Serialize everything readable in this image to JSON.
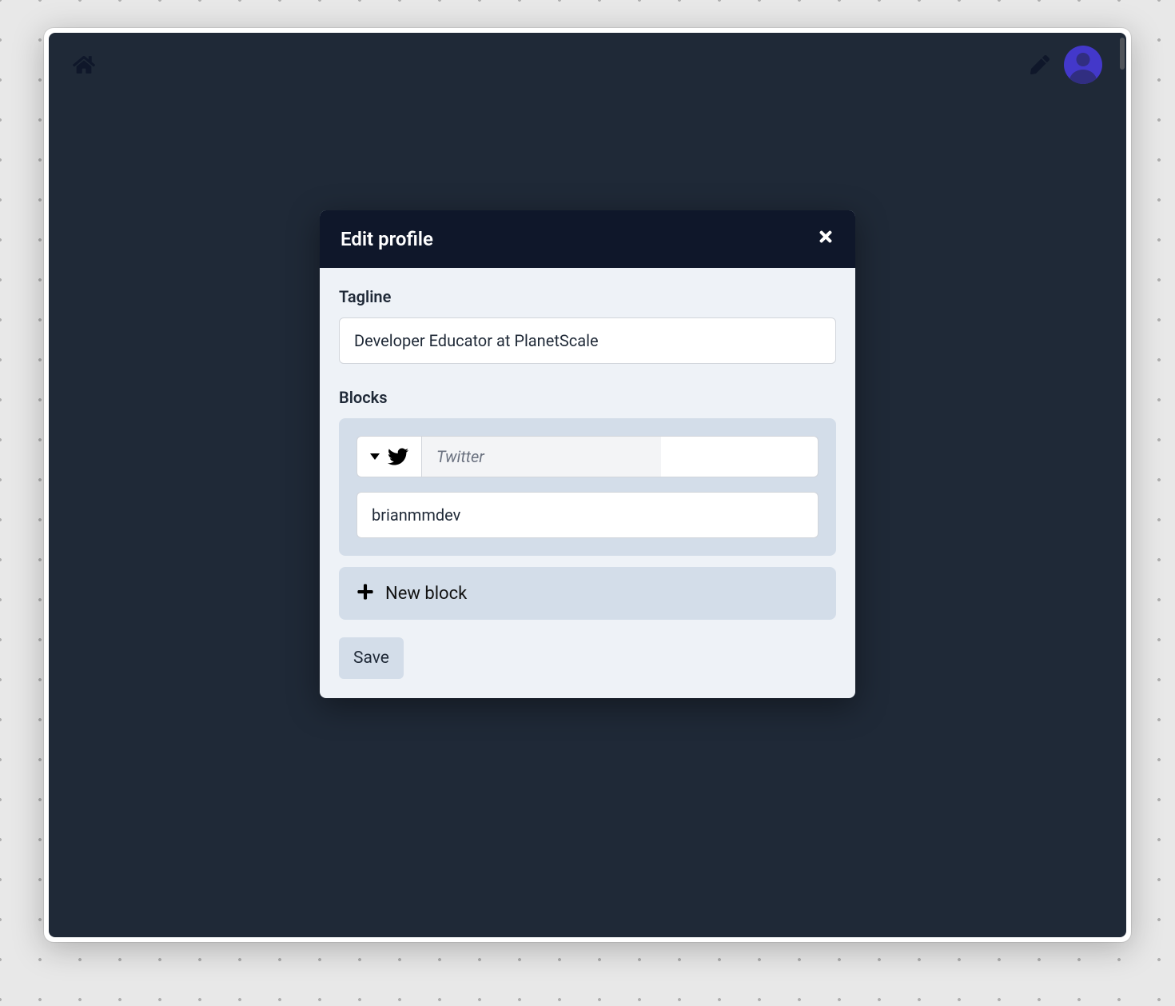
{
  "modal": {
    "title": "Edit profile",
    "tagline_label": "Tagline",
    "tagline_value": "Developer Educator at PlanetScale",
    "blocks_label": "Blocks",
    "block": {
      "type_label": "Twitter",
      "value": "brianmmdev"
    },
    "new_block_label": "New block",
    "save_label": "Save"
  },
  "icons": {
    "home": "home-icon",
    "edit": "pencil-icon",
    "avatar": "avatar",
    "close": "close-icon",
    "twitter": "twitter-icon",
    "caret": "caret-down-icon",
    "plus": "plus-icon"
  }
}
